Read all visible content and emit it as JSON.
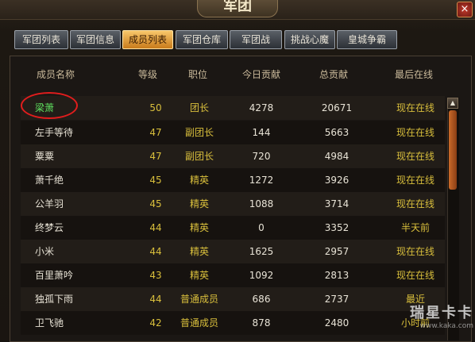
{
  "window": {
    "title": "军团",
    "close_label": "×"
  },
  "tabs": [
    {
      "label": "军团列表",
      "active": false
    },
    {
      "label": "军团信息",
      "active": false
    },
    {
      "label": "成员列表",
      "active": true
    },
    {
      "label": "军团仓库",
      "active": false
    },
    {
      "label": "军团战",
      "active": false
    },
    {
      "label": "挑战心魔",
      "active": false
    },
    {
      "label": "皇城争霸",
      "active": false
    }
  ],
  "table": {
    "headers": {
      "name": "成员名称",
      "level": "等级",
      "role": "职位",
      "today": "今日贡献",
      "total": "总贡献",
      "last": "最后在线"
    },
    "rows": [
      {
        "name": "梁萧",
        "level": "50",
        "role": "团长",
        "today": "4278",
        "total": "20671",
        "last": "现在在线"
      },
      {
        "name": "左手等待",
        "level": "47",
        "role": "副团长",
        "today": "144",
        "total": "5663",
        "last": "现在在线"
      },
      {
        "name": "粟粟",
        "level": "47",
        "role": "副团长",
        "today": "720",
        "total": "4984",
        "last": "现在在线"
      },
      {
        "name": "萧千绝",
        "level": "45",
        "role": "精英",
        "today": "1272",
        "total": "3926",
        "last": "现在在线"
      },
      {
        "name": "公羊羽",
        "level": "45",
        "role": "精英",
        "today": "1088",
        "total": "3714",
        "last": "现在在线"
      },
      {
        "name": "终梦云",
        "level": "44",
        "role": "精英",
        "today": "0",
        "total": "3352",
        "last": "半天前"
      },
      {
        "name": "小米",
        "level": "44",
        "role": "精英",
        "today": "1625",
        "total": "2957",
        "last": "现在在线"
      },
      {
        "name": "百里萧吟",
        "level": "43",
        "role": "精英",
        "today": "1092",
        "total": "2813",
        "last": "现在在线"
      },
      {
        "name": "独孤下雨",
        "level": "44",
        "role": "普通成员",
        "today": "686",
        "total": "2737",
        "last": "最近"
      },
      {
        "name": "卫飞驰",
        "level": "42",
        "role": "普通成员",
        "today": "878",
        "total": "2480",
        "last": "小时前"
      }
    ]
  },
  "watermark": {
    "text": "瑞星卡卡",
    "sub": "www.kaka.com"
  }
}
